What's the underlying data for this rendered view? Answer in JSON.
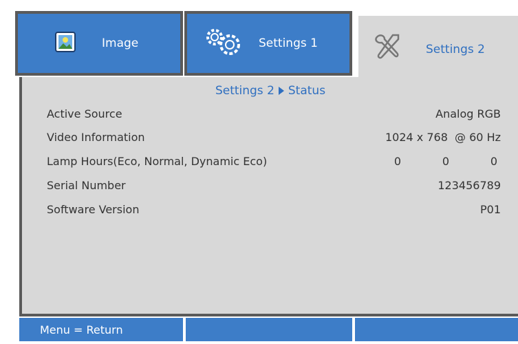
{
  "tabs": {
    "image": {
      "label": "Image",
      "icon": "image-icon"
    },
    "settings1": {
      "label": "Settings 1",
      "icon": "gears-icon"
    },
    "settings2": {
      "label": "Settings 2",
      "icon": "tools-icon"
    }
  },
  "breadcrumb": {
    "section": "Settings 2",
    "page": "Status"
  },
  "status": {
    "active_source": {
      "label": "Active Source",
      "value": "Analog RGB"
    },
    "video_information": {
      "label": "Video Information",
      "value": "1024 x 768  @ 60 Hz"
    },
    "lamp_hours": {
      "label": "Lamp Hours(Eco, Normal, Dynamic Eco)",
      "eco": "0",
      "normal": "0",
      "dynamic_eco": "0"
    },
    "serial_number": {
      "label": "Serial Number",
      "value": "123456789"
    },
    "software_version": {
      "label": "Software Version",
      "value": "P01"
    }
  },
  "footer": {
    "hint": "Menu = Return",
    "center": "",
    "right": ""
  },
  "colors": {
    "tab_blue": "#3d7dc8",
    "panel_grey": "#d8d8d8",
    "border_grey": "#5a5a5a",
    "accent_text": "#2f6fc0"
  }
}
